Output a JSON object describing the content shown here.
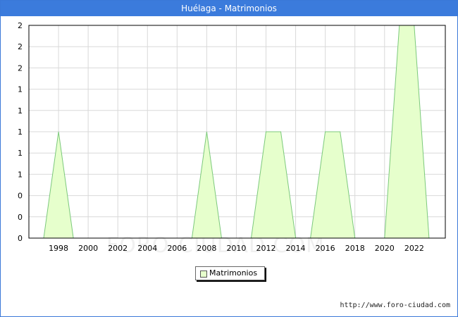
{
  "header": {
    "title": "Huélaga - Matrimonios"
  },
  "watermark": "FORO-CIUDAD.COM",
  "source_url": "http://www.foro-ciudad.com",
  "colors": {
    "title_bar": "#3b7bdc",
    "area_fill": "#e6ffcc",
    "area_stroke": "#7cc97c",
    "grid": "#d9d9d9",
    "axis": "#000000"
  },
  "chart_data": {
    "type": "area",
    "title": "Huélaga - Matrimonios",
    "xlabel": "",
    "ylabel": "",
    "x": [
      1996,
      1997,
      1998,
      1999,
      2000,
      2001,
      2002,
      2003,
      2004,
      2005,
      2006,
      2007,
      2008,
      2009,
      2010,
      2011,
      2012,
      2013,
      2014,
      2015,
      2016,
      2017,
      2018,
      2019,
      2020,
      2021,
      2022,
      2023
    ],
    "series": [
      {
        "name": "Matrimonios",
        "values": [
          0,
          0,
          1,
          0,
          0,
          0,
          0,
          0,
          0,
          0,
          0,
          0,
          1,
          0,
          0,
          0,
          1,
          1,
          0,
          0,
          1,
          1,
          0,
          0,
          0,
          2,
          2,
          0
        ]
      }
    ],
    "x_ticks": [
      "1998",
      "2000",
      "2002",
      "2004",
      "2006",
      "2008",
      "2010",
      "2012",
      "2014",
      "2016",
      "2018",
      "2020",
      "2022"
    ],
    "y_tick_labels": [
      "0",
      "0",
      "0",
      "1",
      "1",
      "1",
      "1",
      "1",
      "2",
      "2",
      "2"
    ],
    "ylim": [
      0,
      2
    ],
    "grid": true,
    "legend": {
      "position": "bottom-center",
      "entries": [
        "Matrimonios"
      ]
    }
  }
}
